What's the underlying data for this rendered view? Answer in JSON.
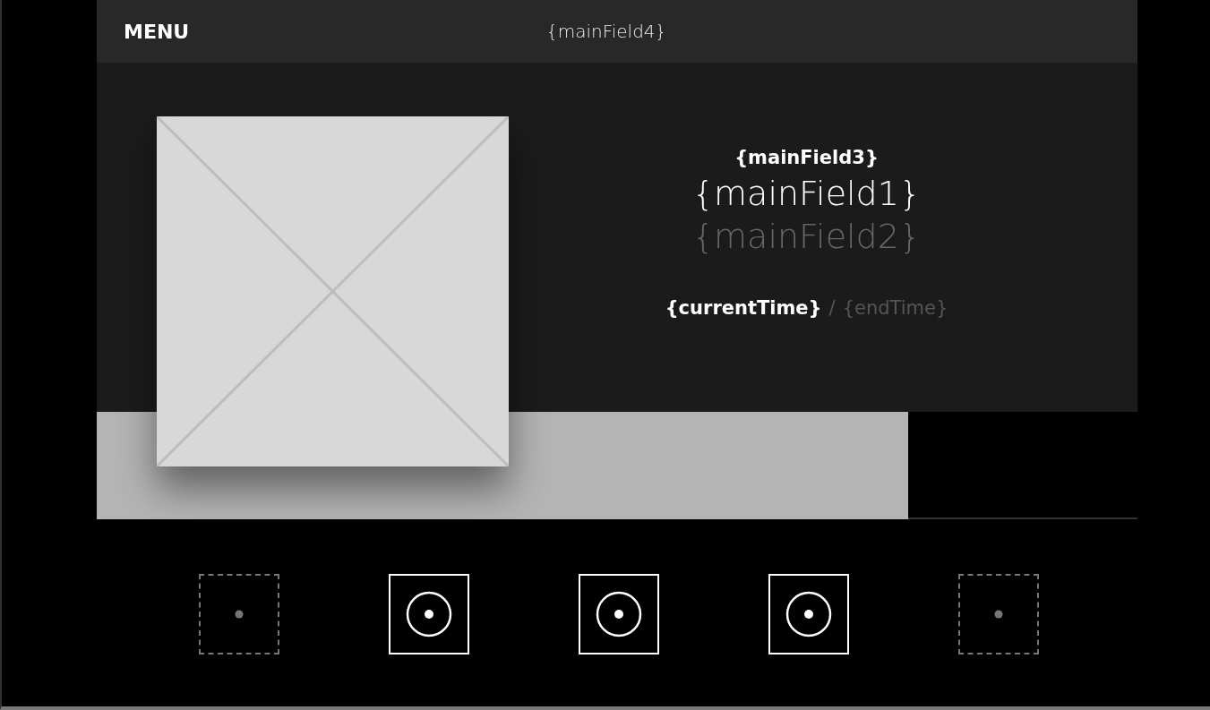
{
  "header": {
    "menu": "MENU",
    "title": "{mainField4}"
  },
  "now_playing": {
    "field3": "{mainField3}",
    "field1": "{mainField1}",
    "field2": "{mainField2}",
    "current_time": "{currentTime}",
    "separator": "/",
    "end_time": "{endTime}"
  },
  "progress": {
    "level": 0.78
  },
  "buttons": [
    {
      "disabled": true
    },
    {
      "disabled": false
    },
    {
      "disabled": false
    },
    {
      "disabled": false
    },
    {
      "disabled": true
    }
  ]
}
